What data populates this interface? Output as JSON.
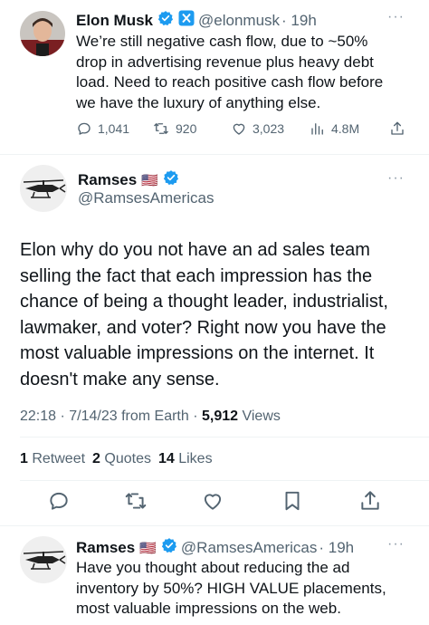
{
  "top_tweet": {
    "name": "Elon Musk",
    "handle": "@elonmusk",
    "time": "· 19h",
    "text_lines": [
      "We’re still negative cash flow, due to ~50%",
      "drop in advertising revenue plus heavy debt",
      "load. Need to reach positive cash flow before",
      "we have the luxury of anything else."
    ],
    "replies": "1,041",
    "retweets": "920",
    "likes": "3,023",
    "views": "4.8M",
    "more": "···"
  },
  "main_tweet": {
    "name": "Ramses",
    "flag": "🇺🇸",
    "handle": "@RamsesAmericas",
    "more": "···",
    "text_lines": [
      "Elon why do you not have an ad sales team",
      "selling the fact that each impression has the",
      "chance of being a thought leader, industrialist,",
      "lawmaker, and voter? Right now you have the",
      "most valuable impressions on the internet. It",
      "doesn't make any sense."
    ],
    "timestamp": "22:18 · 7/14/23 from Earth · ",
    "views_count": "5,912",
    "views_label": " Views",
    "retweets_count": "1",
    "retweets_label": " Retweet",
    "quotes_count": "2",
    "quotes_label": " Quotes",
    "likes_count": "14",
    "likes_label": " Likes"
  },
  "reply_tweet": {
    "name": "Ramses",
    "flag": "🇺🇸",
    "handle": "@RamsesAmericas",
    "time": "· 19h",
    "more": "···",
    "text_lines": [
      "Have you thought about reducing the ad",
      "inventory by 50%? HIGH VALUE placements,",
      "most valuable impressions on the web."
    ]
  },
  "colors": {
    "verified_blue": "#1d9bf0",
    "secondary_text": "#536471",
    "icon_gray": "#536471"
  }
}
